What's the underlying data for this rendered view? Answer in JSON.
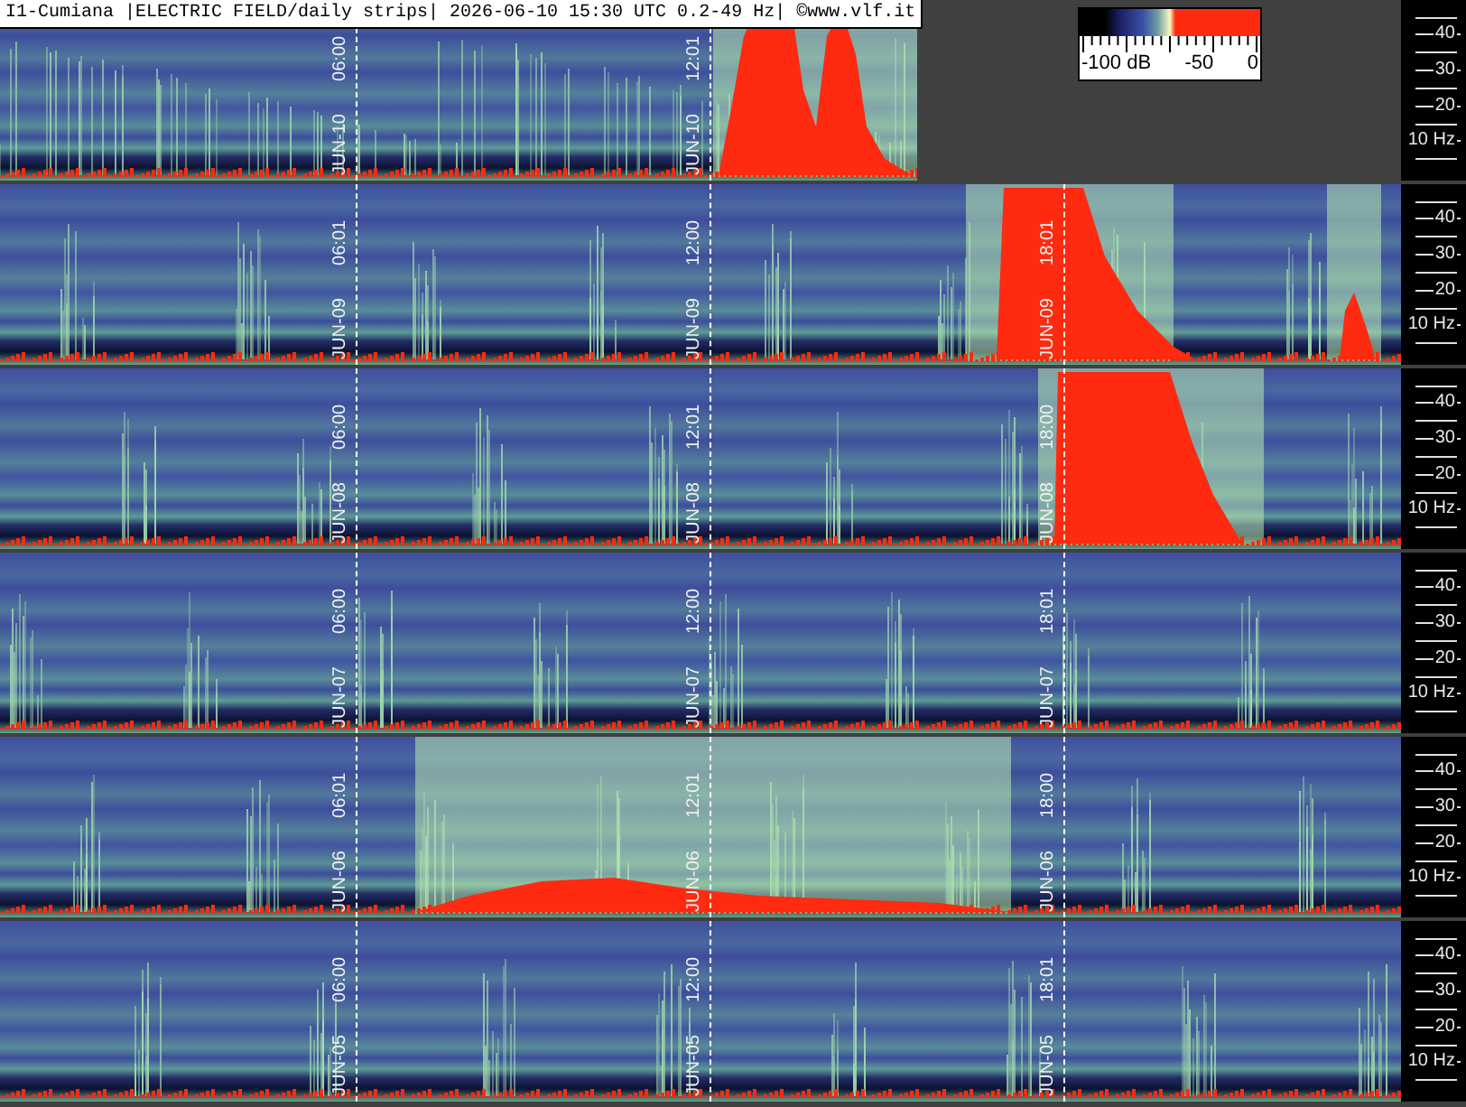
{
  "title": "I1-Cumiana |ELECTRIC FIELD/daily strips| 2026-06-10 15:30 UTC 0.2-49 Hz| ©www.vlf.it",
  "color_scale": {
    "labels": [
      "-100 dB",
      "-50",
      "0"
    ]
  },
  "strips": [
    {
      "markers": [
        {
          "date": "JUN-10",
          "time": "06:00"
        },
        {
          "date": "JUN-10",
          "time": "12:01"
        }
      ],
      "axis": [
        "40",
        "30",
        "20",
        "10 Hz"
      ]
    },
    {
      "markers": [
        {
          "date": "JUN-09",
          "time": "06:01"
        },
        {
          "date": "JUN-09",
          "time": "12:00"
        },
        {
          "date": "JUN-09",
          "time": "18:01"
        }
      ],
      "axis": [
        "40",
        "30",
        "20",
        "10 Hz"
      ]
    },
    {
      "markers": [
        {
          "date": "JUN-08",
          "time": "06:00"
        },
        {
          "date": "JUN-08",
          "time": "12:01"
        },
        {
          "date": "JUN-08",
          "time": "18:00"
        }
      ],
      "axis": [
        "40",
        "30",
        "20",
        "10 Hz"
      ]
    },
    {
      "markers": [
        {
          "date": "JUN-07",
          "time": "06:00"
        },
        {
          "date": "JUN-07",
          "time": "12:00"
        },
        {
          "date": "JUN-07",
          "time": "18:01"
        }
      ],
      "axis": [
        "40",
        "30",
        "20",
        "10 Hz"
      ]
    },
    {
      "markers": [
        {
          "date": "JUN-06",
          "time": "06:01"
        },
        {
          "date": "JUN-06",
          "time": "12:01"
        },
        {
          "date": "JUN-06",
          "time": "18:00"
        }
      ],
      "axis": [
        "40",
        "30",
        "20",
        "10 Hz"
      ]
    },
    {
      "markers": [
        {
          "date": "JUN-05",
          "time": "06:00"
        },
        {
          "date": "JUN-05",
          "time": "12:00"
        },
        {
          "date": "JUN-05",
          "time": "18:01"
        }
      ],
      "axis": [
        "40",
        "30",
        "20",
        "10 Hz"
      ]
    }
  ]
}
